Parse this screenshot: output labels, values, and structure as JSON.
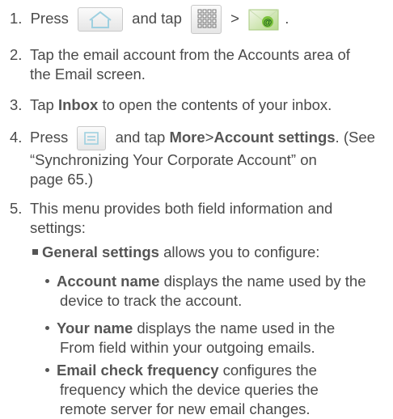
{
  "steps": [
    {
      "num": "1.",
      "pre": "Press",
      "mid": "and tap",
      "gt": ">",
      "end": "."
    },
    {
      "num": "2.",
      "lines": [
        "Tap the email account from the Accounts area of",
        "the Email screen."
      ]
    },
    {
      "num": "3.",
      "pre": "Tap",
      "bold": "Inbox",
      "post": "to open the contents of your inbox."
    },
    {
      "num": "4.",
      "pre": "Press",
      "mid": "and tap",
      "bold1": "More",
      "gt": ">",
      "bold2": "Account settings",
      "post": ". (See",
      "line2": "“Synchronizing Your Corporate Account” on",
      "line3": "page 65.)"
    },
    {
      "num": "5.",
      "lines": [
        "This menu provides both field information and",
        "settings:"
      ]
    }
  ],
  "general": {
    "bold": "General settings",
    "text": "allows you to configure:"
  },
  "bullets": [
    {
      "bold": "Account name",
      "text": "displays the name used by the",
      "lines": [
        "device to track the account."
      ]
    },
    {
      "bold": "Your name",
      "text": "displays the name used in the",
      "lines": [
        "From field within your outgoing emails."
      ]
    },
    {
      "bold": "Email check frequency",
      "text": "configures the",
      "lines": [
        "frequency which the device queries the",
        "remote server for new email changes."
      ]
    }
  ],
  "icons": {
    "home": "home-icon",
    "apps": "apps-grid-icon",
    "email": "email-app-icon",
    "menu": "menu-key-icon"
  },
  "colors": {
    "text": "#4a4a4a",
    "email_green": "#8cc63f",
    "email_at": "#2e7d32"
  }
}
